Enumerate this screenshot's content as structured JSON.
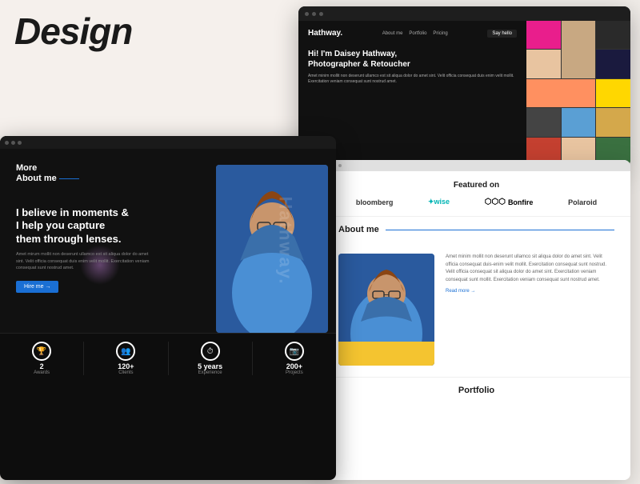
{
  "page": {
    "main_title": "Design"
  },
  "top_browser": {
    "logo": "Hathway.",
    "nav_links": [
      "About me",
      "Portfolio",
      "Pricing"
    ],
    "nav_btn": "Say hello",
    "hero_title": "Hi! I'm Daisey Hathway,\nPhotographer & Retoucher",
    "hero_text": "Amet minim mollit non deserunt ullamco est sit aliqua dolor do amet sint. Velit officia consequat duis enim velit mollit. Exercitation veniam consequat sunt nostrud amet.",
    "image_colors": [
      "#e91e8c",
      "#1a1a2e",
      "#ff6b35",
      "#008080",
      "#ffd700",
      "#555",
      "#fa8072",
      "#228b22",
      "#4169e1",
      "#fffdd0",
      "#cc2200",
      "#800080"
    ]
  },
  "main_browser": {
    "section_label": "More\nAbout me",
    "hero_title": "I believe in moments &\nI help you capture\nthem through lenses.",
    "hero_text": "Amet mirum mollit non deserunt ullamco est sit aliqua dolor do amet sint. Velit officia consequat duis enim velit mollit. Exercitation veniam consequat sunt nostrud amet.",
    "hire_btn": "Hire me →",
    "hathway_watermark": "Hathway.",
    "stats": [
      {
        "icon": "🏆",
        "number": "2",
        "label": "Awards"
      },
      {
        "icon": "👥",
        "number": "120+",
        "label": "Clients"
      },
      {
        "icon": "⏱",
        "number": "5 years",
        "label": "Experience"
      },
      {
        "icon": "📷",
        "number": "200+",
        "label": "Projects"
      }
    ]
  },
  "right_browser": {
    "featured_title": "Featured on",
    "logos": [
      {
        "name": "bloomberg",
        "text": "bloomberg"
      },
      {
        "name": "wise",
        "text": "✦wise"
      },
      {
        "name": "bonfire",
        "text": "Bonfire",
        "has_icon": true
      },
      {
        "name": "polaroid",
        "text": "Polaroid"
      }
    ],
    "about_title": "About me",
    "about_text": "Amet minim mollit non deserunt ullamco sit aliqua dolor do amet sint. Velit officia consequat duis-enim velit mollit. Exercitation consequat sunt nostrud. Velit officia consequat sit aliqua dolor do amet sint. Exercitation veniam consequat sunt mollit. Exercitation veniam consequat sunt nostrud amet.",
    "read_more": "Read more →",
    "portfolio_title": "Portfolio"
  }
}
